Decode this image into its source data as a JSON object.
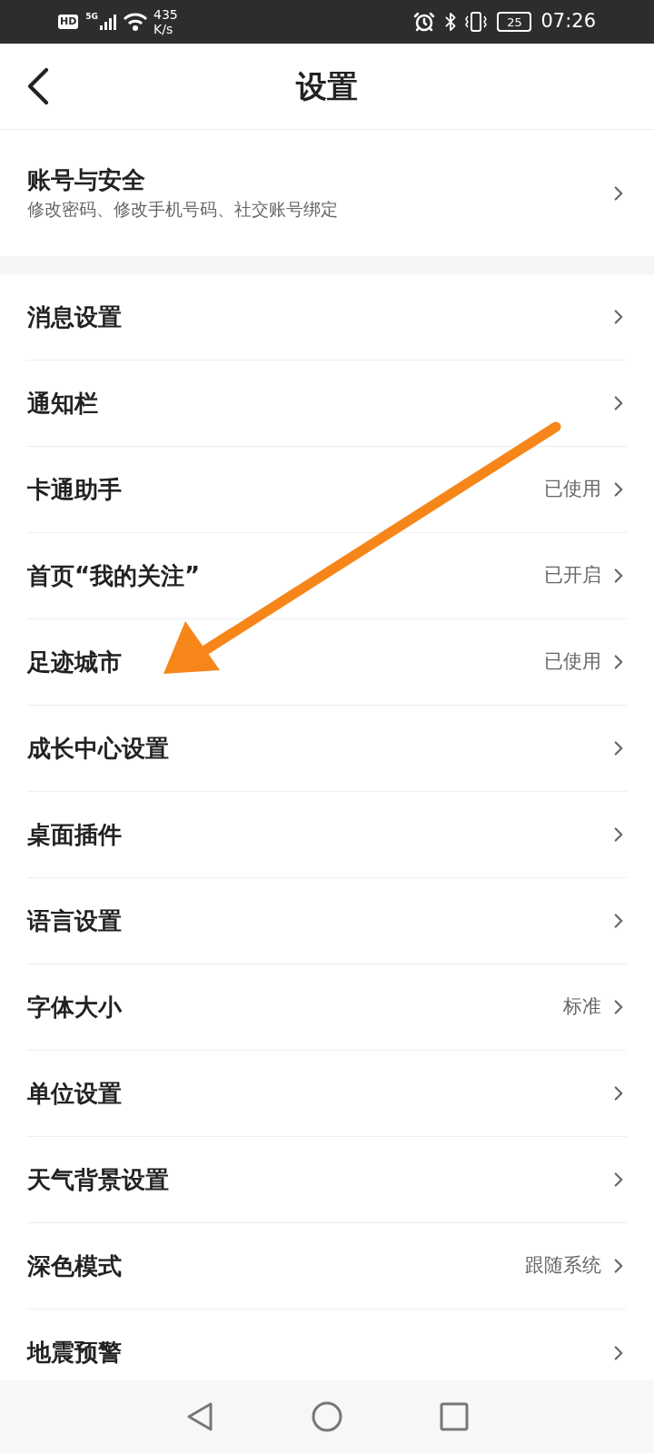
{
  "status_bar": {
    "hd_badge": "HD",
    "network": "5G",
    "speed_value": "435",
    "speed_unit": "K/s",
    "battery": "25",
    "time": "07:26"
  },
  "header": {
    "title": "设置"
  },
  "account": {
    "title": "账号与安全",
    "subtitle": "修改密码、修改手机号码、社交账号绑定"
  },
  "items": [
    {
      "label": "消息设置"
    },
    {
      "label": "通知栏"
    },
    {
      "label": "卡通助手",
      "value": "已使用"
    },
    {
      "label": "首页“我的关注”",
      "value": "已开启"
    },
    {
      "label": "足迹城市",
      "value": "已使用"
    },
    {
      "label": "成长中心设置"
    },
    {
      "label": "桌面插件"
    },
    {
      "label": "语言设置"
    },
    {
      "label": "字体大小",
      "value": "标准"
    },
    {
      "label": "单位设置"
    },
    {
      "label": "天气背景设置"
    },
    {
      "label": "深色模式",
      "value": "跟随系统"
    },
    {
      "label": "地震预警"
    }
  ]
}
